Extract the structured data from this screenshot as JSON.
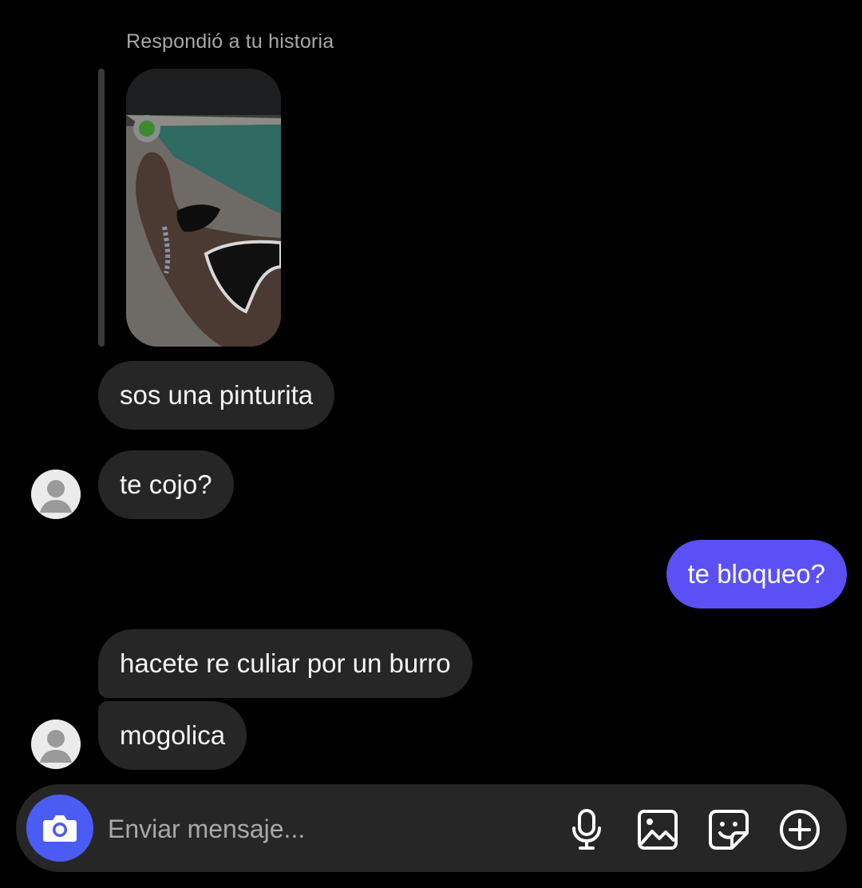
{
  "conversation": {
    "reply_caption": "Respondió a tu historia",
    "story_image": "story-pool-bikini-photo"
  },
  "messages": [
    {
      "sender": "them",
      "text": "sos una pinturita"
    },
    {
      "sender": "them",
      "text": "te cojo?"
    },
    {
      "sender": "me",
      "text": "te bloqueo?"
    },
    {
      "sender": "them",
      "text": "hacete re culiar por un burro"
    },
    {
      "sender": "them",
      "text": "mogolica"
    }
  ],
  "composer": {
    "placeholder": "Enviar mensaje...",
    "icons": [
      "camera-icon",
      "microphone-icon",
      "gallery-icon",
      "sticker-icon",
      "plus-circle-icon"
    ]
  },
  "colors": {
    "background": "#000000",
    "received_bubble": "#262626",
    "sent_bubble": "#5b50f5",
    "camera_button": "#4a5cf3"
  }
}
